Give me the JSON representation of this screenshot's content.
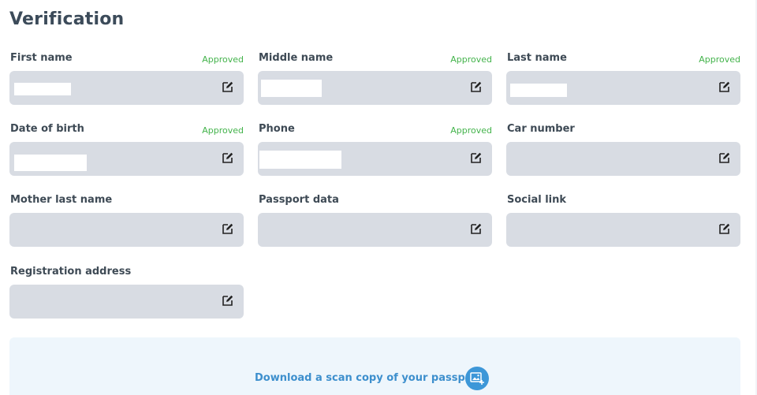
{
  "page": {
    "title": "Verification"
  },
  "fields": [
    {
      "id": "first-name",
      "label": "First name",
      "status": "Approved",
      "value": ""
    },
    {
      "id": "middle-name",
      "label": "Middle name",
      "status": "Approved",
      "value": ""
    },
    {
      "id": "last-name",
      "label": "Last name",
      "status": "Approved",
      "value": ""
    },
    {
      "id": "date-of-birth",
      "label": "Date of birth",
      "status": "Approved",
      "value": ""
    },
    {
      "id": "phone",
      "label": "Phone",
      "status": "Approved",
      "value": ""
    },
    {
      "id": "car-number",
      "label": "Car number",
      "status": "",
      "value": ""
    },
    {
      "id": "mother-last-name",
      "label": "Mother last name",
      "status": "",
      "value": ""
    },
    {
      "id": "passport-data",
      "label": "Passport data",
      "status": "",
      "value": ""
    },
    {
      "id": "social-link",
      "label": "Social link",
      "status": "",
      "value": ""
    },
    {
      "id": "registration-address",
      "label": "Registration address",
      "status": "",
      "value": ""
    }
  ],
  "icons": {
    "edit": "edit-icon",
    "upload": "image-upload-icon"
  },
  "upload": {
    "label": "Download a scan copy of your passport"
  },
  "colors": {
    "approved": "#43b34b",
    "field_bg": "#d8dce3",
    "panel_bg": "#eef6fc",
    "link": "#3d8fcd",
    "upload_icon_bg": "#3d97d8"
  }
}
